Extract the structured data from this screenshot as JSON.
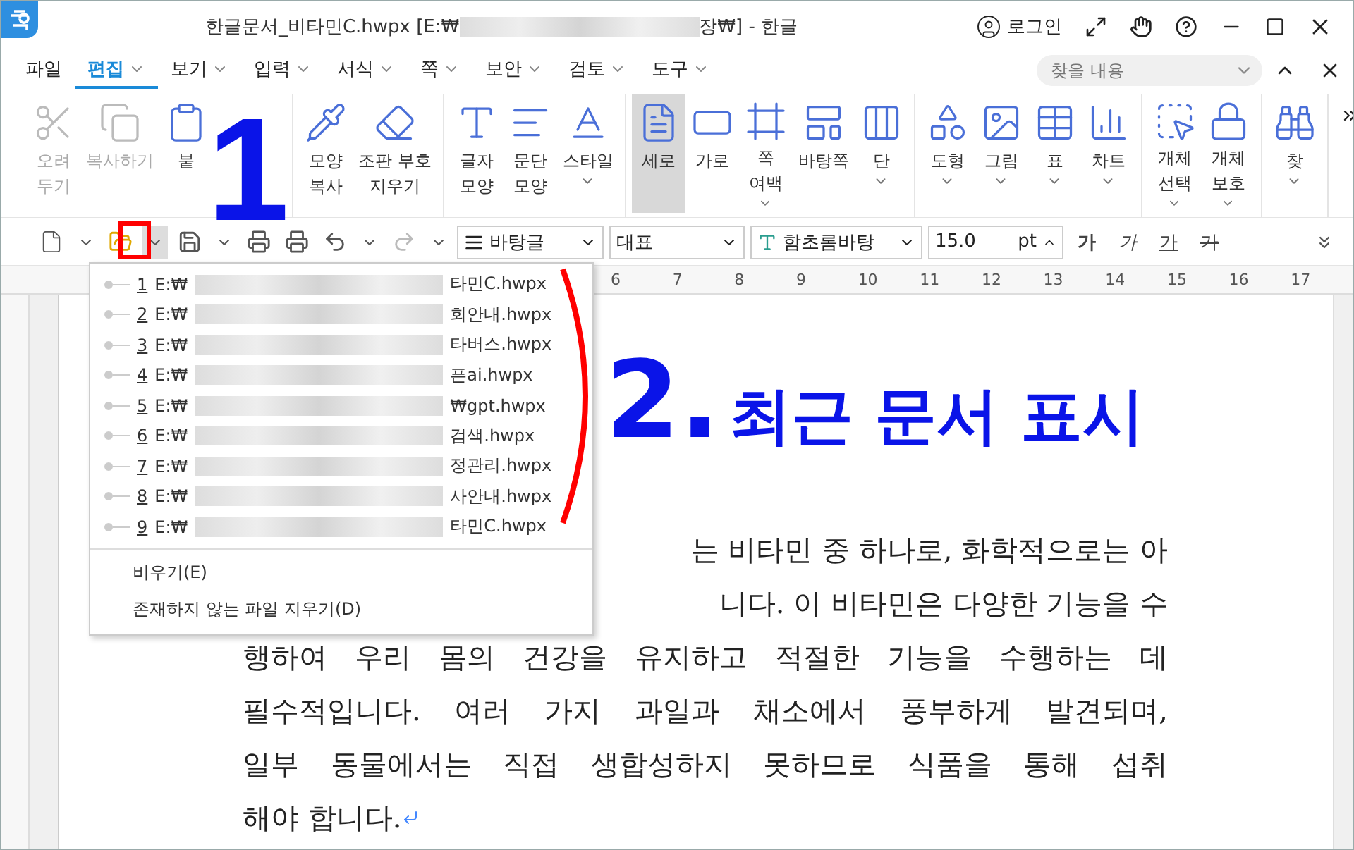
{
  "title_bar": {
    "title_start": "한글문서_비타민C.hwpx [E:₩",
    "title_end": "장₩] - 한글",
    "login": "로그인"
  },
  "menu": {
    "tabs": [
      {
        "label": "파일",
        "selected": false,
        "dropdown": false
      },
      {
        "label": "편집",
        "selected": true,
        "dropdown": true
      },
      {
        "label": "보기",
        "selected": false,
        "dropdown": true
      },
      {
        "label": "입력",
        "selected": false,
        "dropdown": true
      },
      {
        "label": "서식",
        "selected": false,
        "dropdown": true
      },
      {
        "label": "쪽",
        "selected": false,
        "dropdown": true
      },
      {
        "label": "보안",
        "selected": false,
        "dropdown": true
      },
      {
        "label": "검토",
        "selected": false,
        "dropdown": true
      },
      {
        "label": "도구",
        "selected": false,
        "dropdown": true
      }
    ],
    "search": {
      "placeholder": "찾을 내용"
    }
  },
  "ribbon": {
    "groups": [
      [
        {
          "lines": [
            "오려",
            "두기"
          ],
          "disabled": true,
          "selected": false,
          "dropdown": false
        },
        {
          "lines": [
            "복사하기"
          ],
          "disabled": true,
          "selected": false,
          "dropdown": false
        },
        {
          "lines": [
            "붙"
          ],
          "disabled": false,
          "selected": false,
          "dropdown": false
        }
      ],
      [
        {
          "lines": [
            "모양",
            "복사"
          ],
          "disabled": false,
          "selected": false,
          "dropdown": false
        },
        {
          "lines": [
            "조판 부호",
            "지우기"
          ],
          "disabled": false,
          "selected": false,
          "dropdown": false
        }
      ],
      [
        {
          "lines": [
            "글자",
            "모양"
          ],
          "disabled": false,
          "selected": false,
          "dropdown": false
        },
        {
          "lines": [
            "문단",
            "모양"
          ],
          "disabled": false,
          "selected": false,
          "dropdown": false
        },
        {
          "lines": [
            "스타일"
          ],
          "disabled": false,
          "selected": false,
          "dropdown": true
        }
      ],
      [
        {
          "lines": [
            "세로"
          ],
          "disabled": false,
          "selected": true,
          "dropdown": false
        },
        {
          "lines": [
            "가로"
          ],
          "disabled": false,
          "selected": false,
          "dropdown": false
        },
        {
          "lines": [
            "쪽",
            "여백"
          ],
          "disabled": false,
          "selected": false,
          "dropdown": true
        },
        {
          "lines": [
            "바탕쪽"
          ],
          "disabled": false,
          "selected": false,
          "dropdown": false
        },
        {
          "lines": [
            "단"
          ],
          "disabled": false,
          "selected": false,
          "dropdown": true
        }
      ],
      [
        {
          "lines": [
            "도형"
          ],
          "disabled": false,
          "selected": false,
          "dropdown": true
        },
        {
          "lines": [
            "그림"
          ],
          "disabled": false,
          "selected": false,
          "dropdown": true
        },
        {
          "lines": [
            "표"
          ],
          "disabled": false,
          "selected": false,
          "dropdown": true
        },
        {
          "lines": [
            "차트"
          ],
          "disabled": false,
          "selected": false,
          "dropdown": true
        }
      ],
      [
        {
          "lines": [
            "개체",
            "선택"
          ],
          "disabled": false,
          "selected": false,
          "dropdown": true
        },
        {
          "lines": [
            "개체",
            "보호"
          ],
          "disabled": false,
          "selected": false,
          "dropdown": true
        }
      ],
      [
        {
          "lines": [
            "찾"
          ],
          "disabled": false,
          "selected": false,
          "dropdown": true
        }
      ]
    ]
  },
  "format_bar": {
    "para_style": "바탕글",
    "outline": "대표",
    "font": "함초롬바탕",
    "size": "15.0",
    "unit": "pt",
    "char_buttons": [
      {
        "label": "가",
        "kind": "bold"
      },
      {
        "label": "가",
        "kind": "italic"
      },
      {
        "label": "가",
        "kind": "underline"
      },
      {
        "label": "가",
        "kind": "strike"
      }
    ]
  },
  "ruler": {
    "numbers": [
      "6",
      "7",
      "8",
      "9",
      "10",
      "11",
      "12",
      "13",
      "14",
      "15",
      "16",
      "17"
    ]
  },
  "recent_menu": {
    "files": [
      {
        "number": "1",
        "prefix": "E:₩",
        "name": "타민C.hwpx"
      },
      {
        "number": "2",
        "prefix": "E:₩",
        "name": "회안내.hwpx"
      },
      {
        "number": "3",
        "prefix": "E:₩",
        "name": "타버스.hwpx"
      },
      {
        "number": "4",
        "prefix": "E:₩",
        "name": "픈ai.hwpx"
      },
      {
        "number": "5",
        "prefix": "E:₩",
        "name": "₩gpt.hwpx"
      },
      {
        "number": "6",
        "prefix": "E:₩",
        "name": "검색.hwpx"
      },
      {
        "number": "7",
        "prefix": "E:₩",
        "name": "정관리.hwpx"
      },
      {
        "number": "8",
        "prefix": "E:₩",
        "name": "사안내.hwpx"
      },
      {
        "number": "9",
        "prefix": "E:₩",
        "name": "타민C.hwpx"
      }
    ],
    "actions": [
      "비우기(E)",
      "존재하지 않는 파일 지우기(D)"
    ]
  },
  "document": {
    "lines": [
      {
        "text": "는 비타민 중 하나로, 화학적으로는 아",
        "kind": "covered"
      },
      {
        "text": "니다. 이 비타민은 다양한 기능을 수",
        "kind": "covered"
      },
      {
        "text": "행하여 우리 몸의 건강을 유지하고 적절한 기능을 수행하는 데",
        "kind": "full"
      },
      {
        "text": "필수적입니다. 여러 가지 과일과 채소에서 풍부하게 발견되며,",
        "kind": "full"
      },
      {
        "text": "일부 동물에서는 직접 생합성하지 못하므로 식품을 통해 섭취",
        "kind": "full"
      },
      {
        "text": "해야 합니다.",
        "kind": "last"
      }
    ]
  },
  "annotations": [
    {
      "kind": "number",
      "text": "1"
    },
    {
      "kind": "box"
    },
    {
      "kind": "arc"
    },
    {
      "kind": "caption",
      "number": "2.",
      "text": "최근 문서 표시"
    }
  ]
}
